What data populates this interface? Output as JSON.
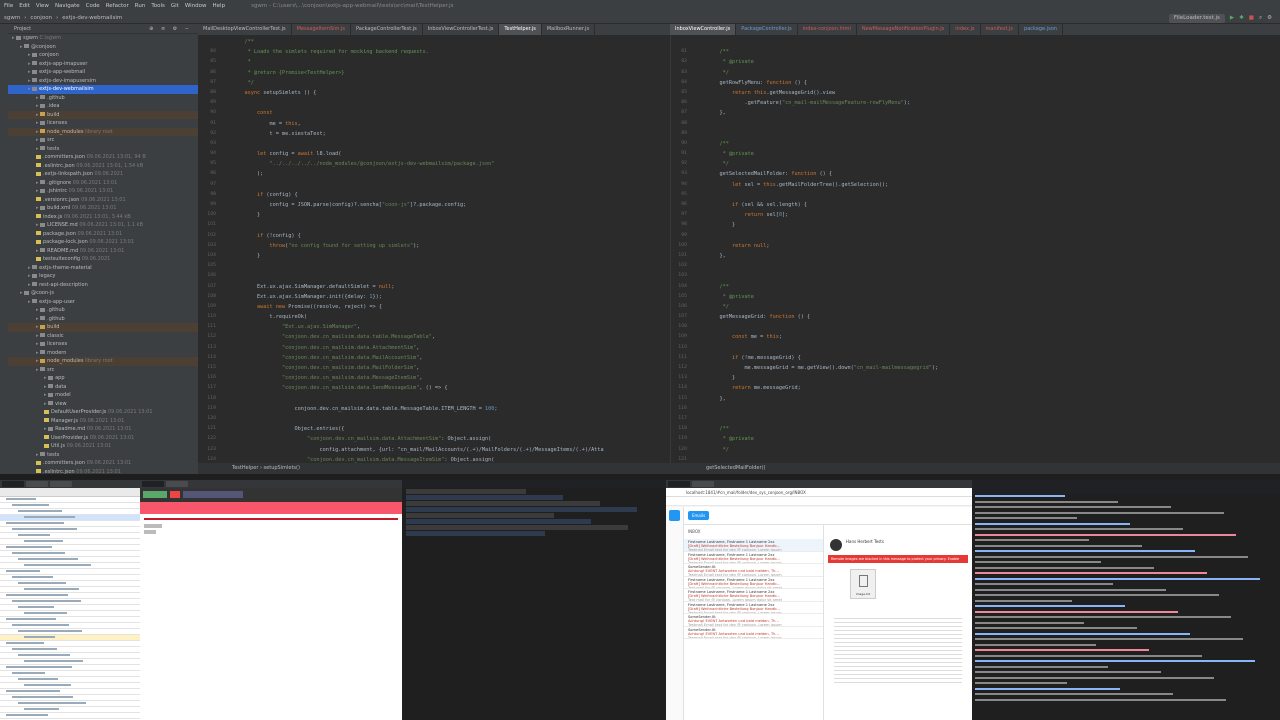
{
  "menu": [
    "File",
    "Edit",
    "View",
    "Navigate",
    "Code",
    "Refactor",
    "Run",
    "Tools",
    "Git",
    "Window",
    "Help",
    "sgwm - C:\\users\\...\\conjoon\\extjs-app-webmail\\tests\\src\\mail\\TestHelper.js"
  ],
  "nav": [
    "sgwm",
    "conjoon",
    "extjs-dev-webmailsim"
  ],
  "run_config": "FileLoader.test.js",
  "project_header": "Project",
  "tree": [
    {
      "indent": 0,
      "icon": "f",
      "text": "sgwm",
      "dim": " C:\\sgwm",
      "cls": ""
    },
    {
      "indent": 1,
      "icon": "f",
      "text": "@conjoon",
      "dim": "",
      "cls": ""
    },
    {
      "indent": 2,
      "icon": "f",
      "text": "conjoon",
      "dim": "",
      "cls": ""
    },
    {
      "indent": 2,
      "icon": "f",
      "text": "extjs-app-imapuser",
      "dim": "",
      "cls": ""
    },
    {
      "indent": 2,
      "icon": "f",
      "text": "extjs-app-webmail",
      "dim": "",
      "cls": ""
    },
    {
      "indent": 2,
      "icon": "f",
      "text": "extjs-dev-imapusersim",
      "dim": "",
      "cls": ""
    },
    {
      "indent": 2,
      "icon": "f",
      "text": "extjs-dev-webmailsim",
      "dim": "",
      "cls": "sel"
    },
    {
      "indent": 3,
      "icon": "f",
      "text": ".github",
      "dim": "",
      "cls": ""
    },
    {
      "indent": 3,
      "icon": "f",
      "text": ".idea",
      "dim": "",
      "cls": ""
    },
    {
      "indent": 3,
      "icon": "o",
      "text": "build",
      "dim": "",
      "cls": "hl"
    },
    {
      "indent": 3,
      "icon": "f",
      "text": "licenses",
      "dim": "",
      "cls": ""
    },
    {
      "indent": 3,
      "icon": "o",
      "text": "node_modules",
      "dim": " library root",
      "cls": "hl"
    },
    {
      "indent": 3,
      "icon": "f",
      "text": "src",
      "dim": "",
      "cls": ""
    },
    {
      "indent": 3,
      "icon": "f",
      "text": "tests",
      "dim": "",
      "cls": ""
    },
    {
      "indent": 3,
      "icon": "j",
      "text": ".committers.json",
      "dim": " 09.06.2021 13:01, 94 B",
      "cls": ""
    },
    {
      "indent": 3,
      "icon": "j",
      "text": ".eslintrc.json",
      "dim": " 09.06.2021 13:01, 1.54 kB",
      "cls": ""
    },
    {
      "indent": 3,
      "icon": "j",
      "text": ".extjs-linkspath.json",
      "dim": " 09.06.2021",
      "cls": ""
    },
    {
      "indent": 3,
      "icon": "f",
      "text": ".gitignore",
      "dim": " 09.06.2021 13:01",
      "cls": ""
    },
    {
      "indent": 3,
      "icon": "f",
      "text": ".jshintrc",
      "dim": " 09.06.2021 13:01",
      "cls": ""
    },
    {
      "indent": 3,
      "icon": "j",
      "text": ".versionrc.json",
      "dim": " 09.06.2021 13:01",
      "cls": ""
    },
    {
      "indent": 3,
      "icon": "f",
      "text": "build.xml",
      "dim": " 09.06.2021 13:01",
      "cls": ""
    },
    {
      "indent": 3,
      "icon": "j",
      "text": "index.js",
      "dim": " 09.06.2021 13:01, 3.44 kB",
      "cls": ""
    },
    {
      "indent": 3,
      "icon": "f",
      "text": "LICENSE.md",
      "dim": " 09.06.2021 13:01, 1.1 kB",
      "cls": ""
    },
    {
      "indent": 3,
      "icon": "j",
      "text": "package.json",
      "dim": " 09.06.2021 13:01",
      "cls": ""
    },
    {
      "indent": 3,
      "icon": "j",
      "text": "package-lock.json",
      "dim": " 09.06.2021 13:01",
      "cls": ""
    },
    {
      "indent": 3,
      "icon": "f",
      "text": "README.md",
      "dim": " 09.06.2021 13:01",
      "cls": ""
    },
    {
      "indent": 3,
      "icon": "j",
      "text": "testsuiteconfig",
      "dim": " 09.06.2021",
      "cls": ""
    },
    {
      "indent": 2,
      "icon": "f",
      "text": "extjs-theme-material",
      "dim": "",
      "cls": ""
    },
    {
      "indent": 2,
      "icon": "f",
      "text": "legacy",
      "dim": "",
      "cls": ""
    },
    {
      "indent": 2,
      "icon": "f",
      "text": "rest-api-description",
      "dim": "",
      "cls": ""
    },
    {
      "indent": 1,
      "icon": "f",
      "text": "@coon-js",
      "dim": "",
      "cls": ""
    },
    {
      "indent": 2,
      "icon": "f",
      "text": "extjs-app-user",
      "dim": "",
      "cls": ""
    },
    {
      "indent": 3,
      "icon": "f",
      "text": ".github",
      "dim": "",
      "cls": ""
    },
    {
      "indent": 3,
      "icon": "f",
      "text": ".github",
      "dim": "",
      "cls": ""
    },
    {
      "indent": 3,
      "icon": "o",
      "text": "build",
      "dim": "",
      "cls": "hl"
    },
    {
      "indent": 3,
      "icon": "f",
      "text": "classic",
      "dim": "",
      "cls": ""
    },
    {
      "indent": 3,
      "icon": "f",
      "text": "licenses",
      "dim": "",
      "cls": ""
    },
    {
      "indent": 3,
      "icon": "f",
      "text": "modern",
      "dim": "",
      "cls": ""
    },
    {
      "indent": 3,
      "icon": "o",
      "text": "node_modules",
      "dim": " library root",
      "cls": "hl"
    },
    {
      "indent": 3,
      "icon": "f",
      "text": "src",
      "dim": "",
      "cls": ""
    },
    {
      "indent": 4,
      "icon": "f",
      "text": "app",
      "dim": "",
      "cls": ""
    },
    {
      "indent": 4,
      "icon": "f",
      "text": "data",
      "dim": "",
      "cls": ""
    },
    {
      "indent": 4,
      "icon": "f",
      "text": "model",
      "dim": "",
      "cls": ""
    },
    {
      "indent": 4,
      "icon": "f",
      "text": "view",
      "dim": "",
      "cls": ""
    },
    {
      "indent": 4,
      "icon": "j",
      "text": "DefaultUserProvider.js",
      "dim": " 09.06.2021 13:01",
      "cls": ""
    },
    {
      "indent": 4,
      "icon": "j",
      "text": "Manager.js",
      "dim": " 09.06.2021 13:01",
      "cls": ""
    },
    {
      "indent": 4,
      "icon": "f",
      "text": "Readme.md",
      "dim": " 09.06.2021 13:01",
      "cls": ""
    },
    {
      "indent": 4,
      "icon": "j",
      "text": "UserProvider.js",
      "dim": " 09.06.2021 13:01",
      "cls": ""
    },
    {
      "indent": 4,
      "icon": "j",
      "text": "Util.js",
      "dim": " 09.06.2021 13:01",
      "cls": ""
    },
    {
      "indent": 3,
      "icon": "f",
      "text": "tests",
      "dim": "",
      "cls": ""
    },
    {
      "indent": 3,
      "icon": "j",
      "text": ".committers.json",
      "dim": " 09.06.2021 13:01",
      "cls": ""
    },
    {
      "indent": 3,
      "icon": "j",
      "text": ".eslintrc.json",
      "dim": " 09.06.2021 13:01",
      "cls": ""
    }
  ],
  "tabs_left": [
    {
      "t": "MailDesktopViewControllerTest.js",
      "c": ""
    },
    {
      "t": "MessageItemSim.js",
      "c": "mod"
    },
    {
      "t": "PackageControllerTest.js",
      "c": ""
    },
    {
      "t": "InboxViewControllerTest.js",
      "c": ""
    },
    {
      "t": "TestHelper.js",
      "c": "act"
    },
    {
      "t": "MailboxRunner.js",
      "c": ""
    }
  ],
  "tabs_right": [
    {
      "t": "InboxViewController.js",
      "c": "act"
    },
    {
      "t": "PackageController.js",
      "c": "blu"
    },
    {
      "t": "index-conjoon.html",
      "c": "mod"
    },
    {
      "t": "NewMessageNotificationPlugin.js",
      "c": "mod"
    },
    {
      "t": "index.js",
      "c": "mod"
    },
    {
      "t": "manifest.js",
      "c": "mod"
    },
    {
      "t": "package.json",
      "c": "blu"
    }
  ],
  "gutter_left": [
    "",
    "84",
    "85",
    "86",
    "87",
    "88",
    "89",
    "90",
    "91",
    "92",
    "93",
    "94",
    "95",
    "96",
    "97",
    "98",
    "99",
    "100",
    "101",
    "102",
    "103",
    "104",
    "105",
    "106",
    "107",
    "108",
    "109",
    "110",
    "111",
    "112",
    "113",
    "114",
    "115",
    "116",
    "117",
    "118",
    "119",
    "120",
    "121",
    "122",
    "123",
    "124",
    "125"
  ],
  "gutter_right": [
    "",
    "81",
    "82",
    "83",
    "84",
    "85",
    "86",
    "87",
    "88",
    "89",
    "90",
    "91",
    "92",
    "93",
    "94",
    "95",
    "96",
    "97",
    "98",
    "99",
    "100",
    "101",
    "102",
    "103",
    "104",
    "105",
    "106",
    "107",
    "108",
    "109",
    "110",
    "111",
    "112",
    "113",
    "114",
    "115",
    "116",
    "117",
    "118",
    "119",
    "120",
    "121",
    "122"
  ],
  "code_left": [
    "    /**",
    "     * Loads the simlets required for mocking backend requests.",
    "     *",
    "     * @return {Promise<TestHelper>}",
    "     */",
    "    async setupSimlets () {",
    "",
    "        const",
    "            me = this,",
    "            t = me.siestaTest;",
    "",
    "        let config = await l8.load(",
    "            \"../../../../../node_modules/@conjoon/extjs-dev-webmailsim/package.json\"",
    "        );",
    "",
    "        if (config) {",
    "            config = JSON.parse(config)?.sencha[\"coon-js\"]?.package.config;",
    "        }",
    "",
    "        if (!config) {",
    "            throw(\"no config found for setting up simlets\");",
    "        }",
    "",
    "",
    "        Ext.ux.ajax.SimManager.defaultSimlet = null;",
    "        Ext.ux.ajax.SimManager.init({delay: 1});",
    "        await new Promise((resolve, reject) => {",
    "            t.requireOk(",
    "                \"Ext.ux.ajax.SimManager\",",
    "                \"conjoon.dev.cn_mailsim.data.table.MessageTable\",",
    "                \"conjoon.dev.cn_mailsim.data.AttachmentSim\",",
    "                \"conjoon.dev.cn_mailsim.data.MailAccountSim\",",
    "                \"conjoon.dev.cn_mailsim.data.MailFolderSim\",",
    "                \"conjoon.dev.cn_mailsim.data.MessageItemSim\",",
    "                \"conjoon.dev.cn_mailsim.data.SendMessageSim\", () => {",
    "",
    "                    conjoon.dev.cn_mailsim.data.table.MessageTable.ITEM_LENGTH = 100;",
    "",
    "                    Object.entries({",
    "                        \"conjoon.dev.cn_mailsim.data.AttachmentSim\": Object.assign(",
    "                            config.attachment, {url: \"cn_mail/MailAccounts/(.+)/MailFolders/(.+)/MessageItems/(.+)/Atta",
    "                        \"conjoon.dev.cn_mailsim.data.MessageItemSim\": Object.assign("
  ],
  "code_right": [
    "",
    "    /**",
    "     * @private",
    "     */",
    "    getRowFlyMenu: function () {",
    "        return this.getMessageGrid().view",
    "            .getFeature(\"cn_mail-mailMessageFeature-rowFlyMenu\");",
    "    },",
    "",
    "",
    "    /**",
    "     * @private",
    "     */",
    "    getSelectedMailFolder: function () {",
    "        let sel = this.getMailFolderTree().getSelection();",
    "",
    "        if (sel && sel.length) {",
    "            return sel[0];",
    "        }",
    "",
    "        return null;",
    "    },",
    "",
    "",
    "    /**",
    "     * @private",
    "     */",
    "    getMessageGrid: function () {",
    "",
    "        const me = this;",
    "",
    "        if (!me.messageGrid) {",
    "            me.messageGrid = me.getView().down(\"cn_mail-mailmessagegrid\");",
    "        }",
    "        return me.messageGrid;",
    "    },",
    "",
    "",
    "    /**",
    "     * @private",
    "     */",
    "",
    ""
  ],
  "crumbs_left": "TestHelper  ›  setupSimlets()",
  "crumbs_right": "getSelectedMailFolder()",
  "browser_b4": {
    "url": "localhost:1841/#cn_mail/folder/dev_sys_conjoon_org/INBOX",
    "folder": "INBOX",
    "warning": "Remote images are blocked in this message to protect your privacy. Enable",
    "sender": "Hans Herbert Tests",
    "attachment": "image.txt",
    "messages": [
      {
        "a": "Firstname Lastname, Firstname 1 Lastname 2xx",
        "s": "[Draft] Weihnachtliche Bestellung Bonjour Handb...",
        "p": "Testmail Email text for dev @ conjoon. Lorem ipsum"
      },
      {
        "a": "Firstname Lastname, Firstname 1 Lastname 2xx",
        "s": "[Draft] Weihnachtliche Bestellung Bonjour Handb...",
        "p": "Testmail Email text for dev @ conjoon. Lorem ipsum"
      },
      {
        "a": "SomeSender.Xt",
        "s": "Achtung! EVENT Antworten und bald melden, Th...",
        "p": "Testmail Email text for dev @ conjoon. Lorem ipsum"
      },
      {
        "a": "Firstname Lastname, Firstname 1 Lastname 2xx",
        "s": "[Draft] Weihnachtliche Bestellung Bonjour Handb...",
        "p": "Text mail for @ conjoon. Lorem ipsum dolor sit amet"
      },
      {
        "a": "Firstname Lastname, Firstname 1 Lastname 2xx",
        "s": "[Draft] Weihnachtliche Bestellung Bonjour Handb...",
        "p": "Text mail for @ conjoon. Lorem ipsum dolor sit amet"
      },
      {
        "a": "Firstname Lastname, Firstname 1 Lastname 2xx",
        "s": "[Draft] Weihnachtliche Bestellung Bonjour Handb...",
        "p": "Testmail Email text for dev @ conjoon. Lorem ipsum"
      },
      {
        "a": "SomeSender.Xt",
        "s": "Achtung! EVENT Antworten und bald melden, Th...",
        "p": "Testmail Email text for dev @ conjoon. Lorem ipsum"
      },
      {
        "a": "SomeSender.Xt",
        "s": "Achtung! EVENT Antworten und bald melden, Th...",
        "p": "Testmail Email text for dev @ conjoon. Lorem ipsum"
      }
    ]
  },
  "compose_label": "Emails",
  "colors": {
    "ide_bg": "#2b2b2b",
    "selection": "#2f65ca",
    "accent_blue": "#2196f3",
    "error_red": "#e53935"
  }
}
